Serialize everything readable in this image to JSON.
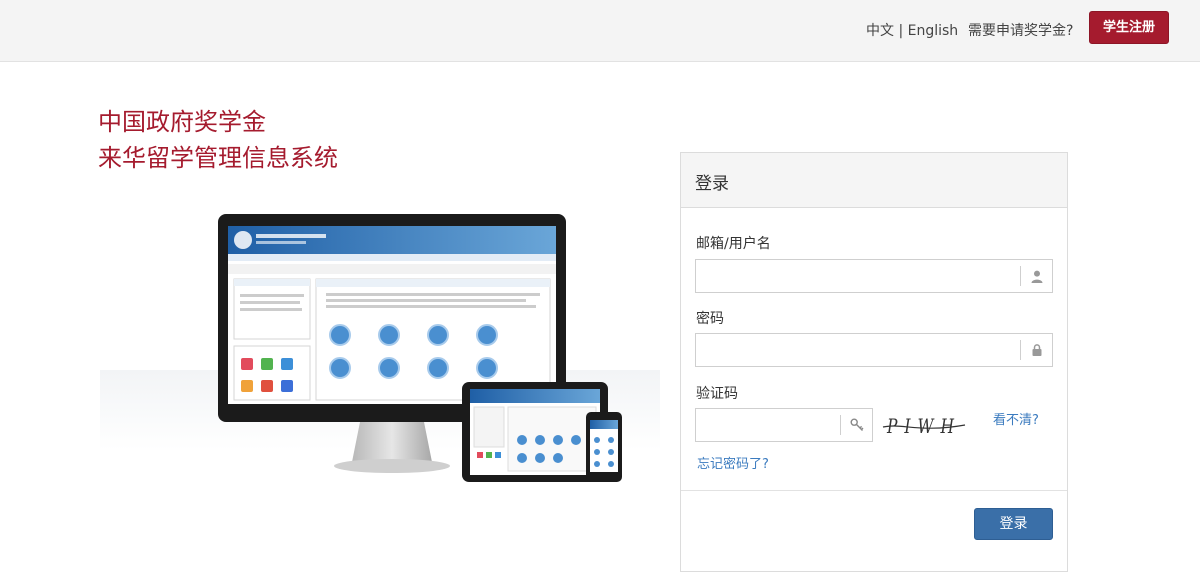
{
  "header": {
    "lang_zh": "中文",
    "lang_sep": " | ",
    "lang_en": "English",
    "apply_question": "需要申请奖学金?",
    "register_label": "学生注册"
  },
  "hero": {
    "title_line1": "中国政府奖学金",
    "title_line2": "来华留学管理信息系统"
  },
  "login": {
    "panel_title": "登录",
    "email_label": "邮箱/用户名",
    "email_value": "",
    "password_label": "密码",
    "password_value": "",
    "captcha_label": "验证码",
    "captcha_value": "",
    "captcha_text": "PIWH",
    "refresh_captcha": "看不清?",
    "forgot_password": "忘记密码了?",
    "submit_label": "登录"
  },
  "icons": {
    "email_addon": "user-icon",
    "password_addon": "lock-icon",
    "captcha_addon": "key-icon"
  },
  "colors": {
    "brand_red": "#a51b2e",
    "primary_blue": "#3a6fa8",
    "link_blue": "#3b7bbf"
  }
}
